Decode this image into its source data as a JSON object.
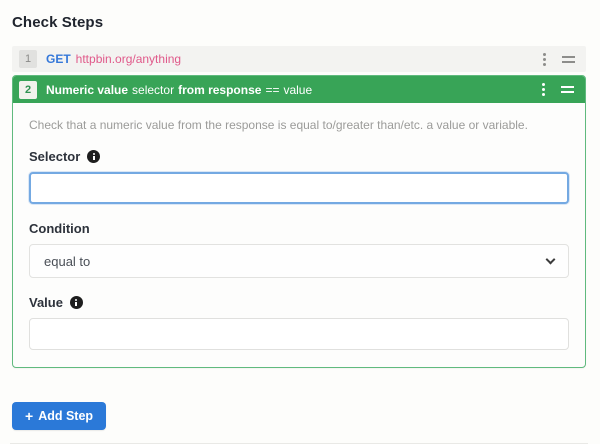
{
  "page": {
    "title": "Check Steps"
  },
  "colors": {
    "step_header_green": "#38a457",
    "card_border_green": "#60ba7e",
    "primary_button_blue": "#2b79d8",
    "method_blue": "#3578d9",
    "url_pink": "#e0598a",
    "focused_input_blue": "#74a9e2",
    "collapsed_row_gray": "#f3f3f1"
  },
  "step1": {
    "number": "1",
    "method": "GET",
    "url": "httpbin.org/anything"
  },
  "step2": {
    "number": "2",
    "title": {
      "bold1": "Numeric value",
      "regular1": "selector",
      "bold2": "from response",
      "operator": "==",
      "regular2": "value"
    },
    "description": "Check that a numeric value from the response is equal to/greater than/etc. a value or variable.",
    "selector": {
      "label": "Selector",
      "value": ""
    },
    "condition": {
      "label": "Condition",
      "selected": "equal to"
    },
    "value_field": {
      "label": "Value",
      "value": ""
    }
  },
  "add_step": {
    "plus": "+",
    "label": "Add Step"
  }
}
